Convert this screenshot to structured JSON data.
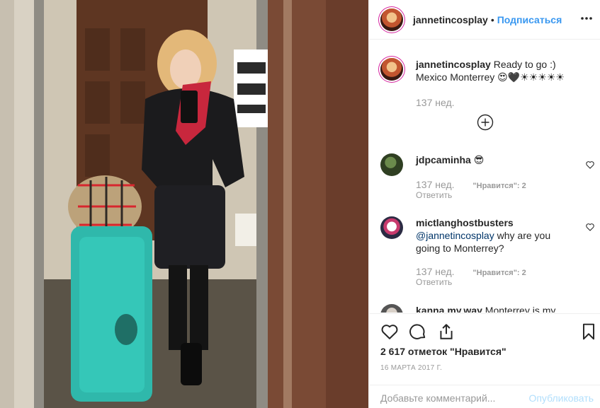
{
  "post": {
    "username": "jannetincosplay",
    "separator": "•",
    "follow_label": "Подписаться",
    "more_icon": "more-horizontal-icon"
  },
  "caption": {
    "username": "jannetincosplay",
    "text_line1": "Ready to go :)",
    "text_line2": "Mexico Monterrey 😍🖤☀☀☀☀☀",
    "time": "137 нед."
  },
  "load_more_icon": "plus-circle-icon",
  "comments": [
    {
      "username": "jdpcaminha",
      "text": "😎",
      "time": "137 нед.",
      "likes": "\"Нравится\": 2",
      "reply": "Ответить"
    },
    {
      "username": "mictlanghostbusters",
      "mention": "@jannetincosplay",
      "text": " why are you going to Monterrey?",
      "time": "137 нед.",
      "likes": "\"Нравится\": 2",
      "reply": "Ответить"
    },
    {
      "username": "kanna.my.way",
      "text": "Monterrey is my"
    }
  ],
  "actions": {
    "like_icon": "heart-icon",
    "comment_icon": "comment-icon",
    "share_icon": "share-icon",
    "save_icon": "bookmark-icon"
  },
  "likes_total": "2 617 отметок \"Нравится\"",
  "date": "16 МАРТА 2017 Г.",
  "comment_box": {
    "placeholder": "Добавьте комментарий...",
    "publish_label": "Опубликовать"
  },
  "colors": {
    "link_blue": "#3897f0",
    "publish_disabled": "#b2dffc",
    "muted_text": "#999999"
  }
}
